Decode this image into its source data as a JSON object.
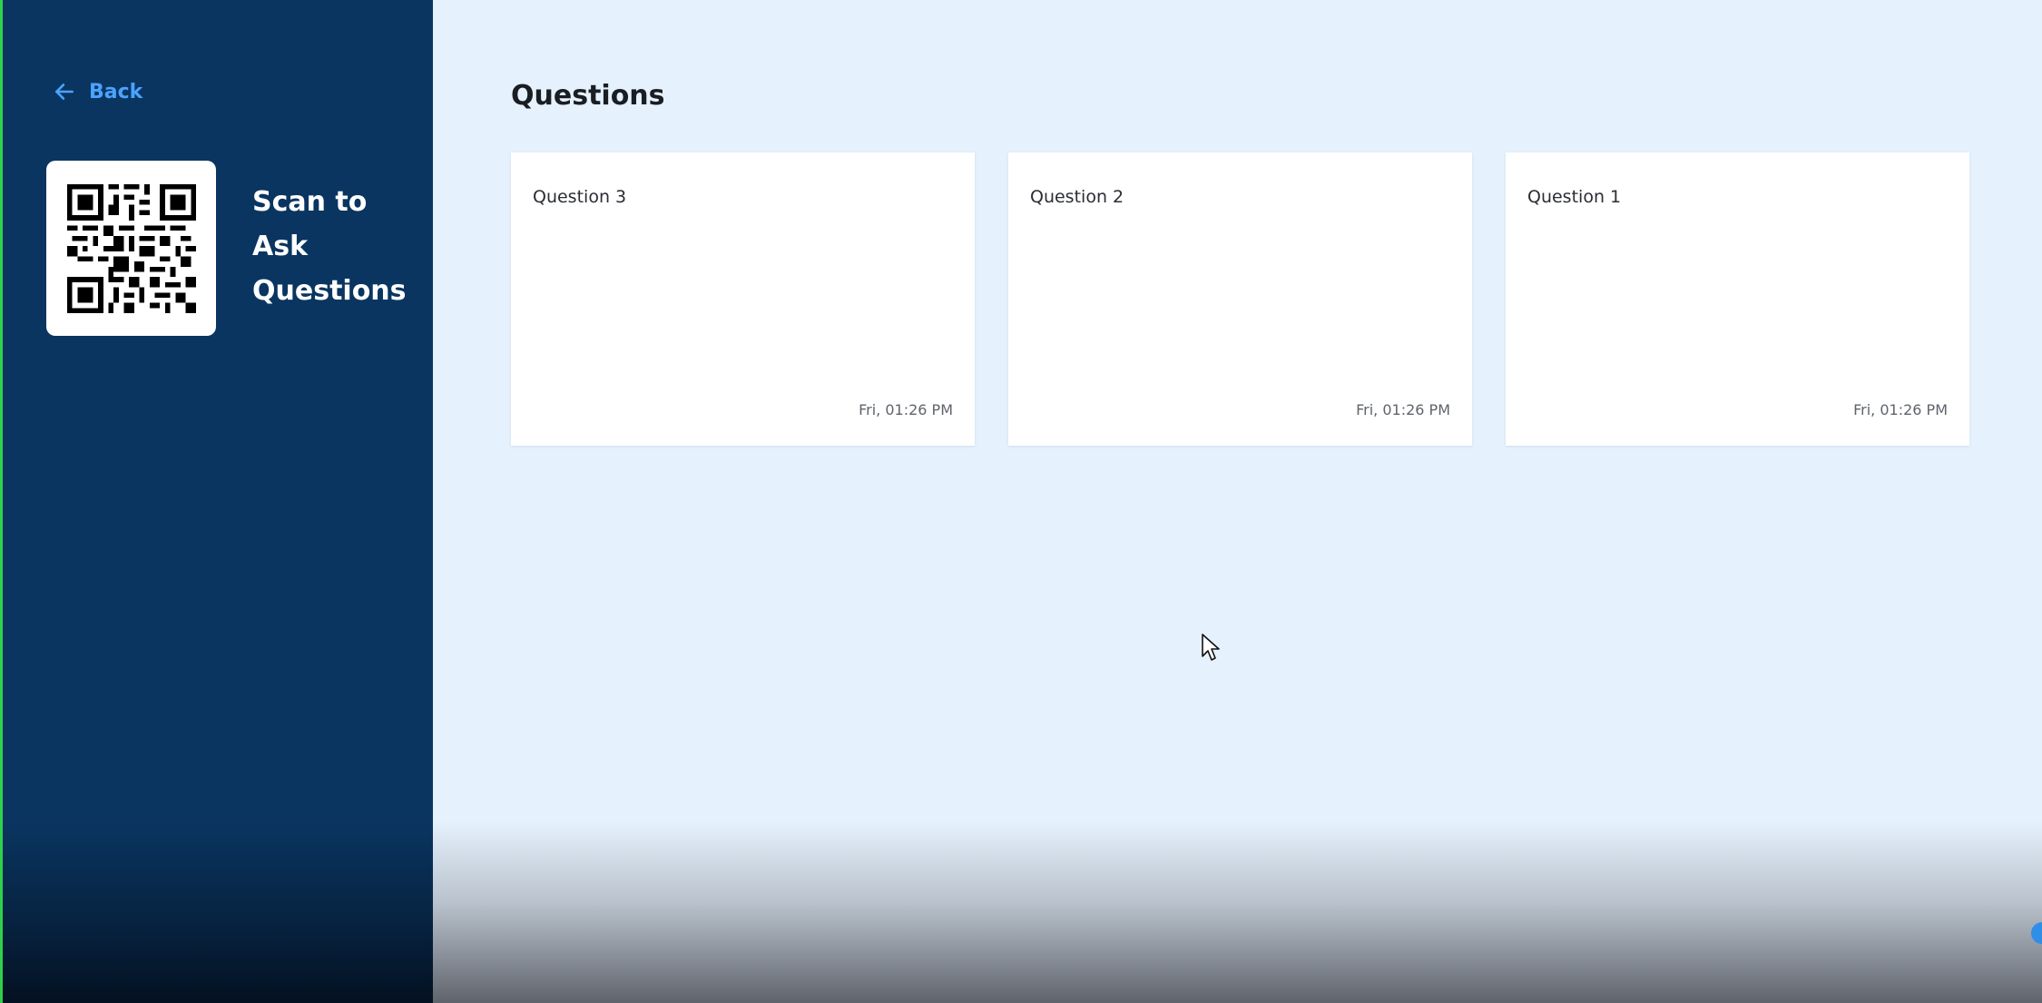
{
  "sidebar": {
    "back_label": "Back",
    "scan_text": [
      "Scan to",
      "Ask",
      "Questions"
    ]
  },
  "main": {
    "title": "Questions",
    "cards": [
      {
        "question": "Question 3",
        "time": "Fri, 01:26 PM"
      },
      {
        "question": "Question 2",
        "time": "Fri, 01:26 PM"
      },
      {
        "question": "Question 1",
        "time": "Fri, 01:26 PM"
      }
    ]
  },
  "icons": {
    "back": "arrow-left-icon",
    "qr": "qr-code-icon",
    "cursor": "mouse-pointer-icon"
  },
  "colors": {
    "sidebar_bg": "#0a3561",
    "main_bg": "#e5f1fd",
    "accent": "#4aa3ff",
    "card_bg": "#ffffff"
  }
}
